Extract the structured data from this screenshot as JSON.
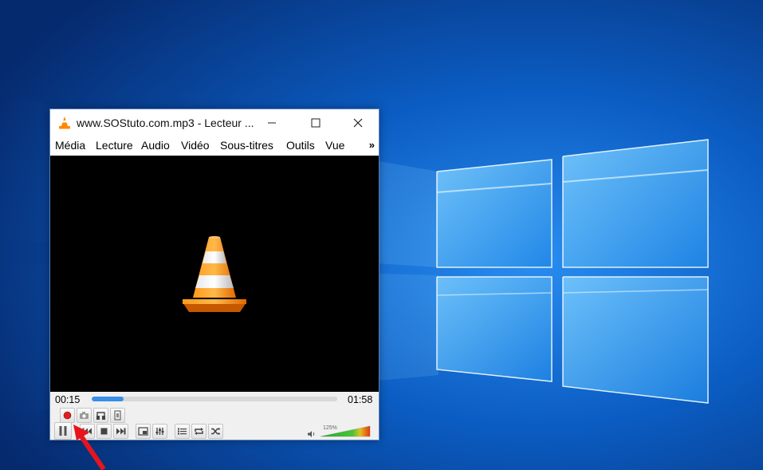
{
  "window": {
    "title": "www.SOStuto.com.mp3 - Lecteur ...",
    "app_icon": "vlc-cone-icon",
    "minimize_icon": "minimize-icon",
    "maximize_icon": "maximize-icon",
    "close_icon": "close-icon"
  },
  "menu": {
    "items": [
      {
        "label": "Média"
      },
      {
        "label": "Lecture"
      },
      {
        "label": "Audio"
      },
      {
        "label": "Vidéo"
      },
      {
        "label": "Sous-titres"
      },
      {
        "label": "Outils"
      },
      {
        "label": "Vue"
      }
    ],
    "more": "»"
  },
  "playback": {
    "elapsed": "00:15",
    "duration": "01:58",
    "progress_fraction": 0.13
  },
  "volume": {
    "label": "125%",
    "level_fraction": 1.0
  },
  "colors": {
    "desktop": "#0a3a8a",
    "seek_fill": "#3a8ee6",
    "record": "#e02020",
    "arrow": "#e8141c"
  }
}
